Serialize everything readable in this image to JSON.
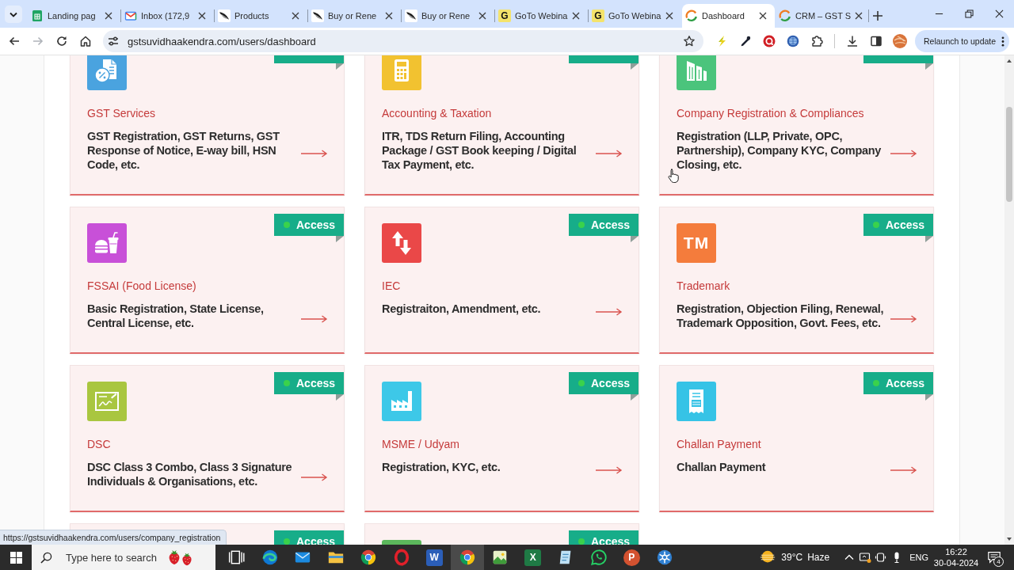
{
  "browser": {
    "tabs": [
      {
        "title": "Landing pag",
        "kind": "sheets",
        "selected": false
      },
      {
        "title": "Inbox (172,9",
        "kind": "mail",
        "selected": false
      },
      {
        "title": "Products",
        "kind": "quill",
        "selected": false
      },
      {
        "title": "Buy or Rene",
        "kind": "quill",
        "selected": false
      },
      {
        "title": "Buy or Rene",
        "kind": "quill",
        "selected": false
      },
      {
        "title": "GoTo Webina",
        "kind": "letter",
        "letter": "G",
        "selected": false
      },
      {
        "title": "GoTo Webina",
        "kind": "letter",
        "letter": "G",
        "selected": false
      },
      {
        "title": "Dashboard",
        "kind": "swoosh",
        "selected": true
      },
      {
        "title": "CRM – GST S",
        "kind": "swoosh",
        "selected": false
      }
    ],
    "forward_disabled": true,
    "url": "gstsuvidhaakendra.com/users/dashboard",
    "relaunch_button": "Relaunch to update",
    "status_url": "https://gstsuvidhaakendra.com/users/company_registration"
  },
  "services": [
    {
      "title": "GST Services",
      "description": "GST Registration, GST Returns, GST Response of Notice, E-way bill, HSN Code, etc.",
      "kind": "tax-document",
      "color": "#4aa3df",
      "has_access": true
    },
    {
      "title": "Accounting & Taxation",
      "description": "ITR, TDS Return Filing, Accounting Package / GST Book keeping / Digital Tax Payment, etc.",
      "kind": "calculator",
      "color": "#f2c230",
      "has_access": true
    },
    {
      "title": "Company Registration & Compliances",
      "description": "Registration (LLP, Private, OPC, Partnership), Company KYC, Company Closing, etc.",
      "kind": "buildings",
      "color": "#4bc47c",
      "has_access": true
    },
    {
      "title": "FSSAI (Food License)",
      "description": "Basic Registration, State License, Central License, etc.",
      "kind": "food",
      "color": "#c850d8",
      "has_access": true,
      "access_label": "Access"
    },
    {
      "title": "IEC",
      "description": "Registraiton, Amendment, etc.",
      "kind": "transfer",
      "color": "#ea4848",
      "has_access": true,
      "access_label": "Access"
    },
    {
      "title": "Trademark",
      "description": "Registration, Objection Filing, Renewal, Trademark Opposition, Govt. Fees, etc.",
      "kind": "trademark",
      "icon_text": "TM",
      "color": "#f47c3c",
      "has_access": true,
      "access_label": "Access"
    },
    {
      "title": "DSC",
      "description": "DSC Class 3 Combo, Class 3 Signature Individuals & Organisations, etc.",
      "kind": "certificate",
      "color": "#a9c640",
      "has_access": true,
      "access_label": "Access"
    },
    {
      "title": "MSME / Udyam",
      "description": "Registration, KYC, etc.",
      "kind": "factory",
      "color": "#3dc8e8",
      "has_access": true,
      "access_label": "Access"
    },
    {
      "title": "Challan Payment",
      "description": "Challan Payment",
      "kind": "receipt",
      "color": "#36c3e6",
      "has_access": true,
      "access_label": "Access"
    },
    {
      "has_access": true,
      "access_label": "Access"
    },
    {
      "kind": "tile",
      "color": "#5cb85c",
      "has_access": true,
      "access_label": "Access"
    }
  ],
  "taskbar": {
    "search_placeholder": "Type here to search",
    "apps": [
      {
        "kind": "edge",
        "selected": false
      },
      {
        "kind": "mail",
        "selected": false
      },
      {
        "kind": "folder",
        "selected": false
      },
      {
        "kind": "chrome",
        "selected": false
      },
      {
        "kind": "opera",
        "selected": false
      },
      {
        "kind": "letter-square",
        "letter": "W",
        "color": "#2b5eb8",
        "selected": false
      },
      {
        "kind": "chrome",
        "selected": true
      },
      {
        "kind": "photo",
        "selected": false
      },
      {
        "kind": "letter-square",
        "letter": "X",
        "color": "#1f7a45",
        "selected": false
      },
      {
        "kind": "notepad",
        "selected": false
      },
      {
        "kind": "chat",
        "selected": false
      },
      {
        "kind": "letter-circle",
        "letter": "P",
        "color": "#d35230",
        "selected": false
      },
      {
        "kind": "snowflake",
        "selected": false
      }
    ],
    "weather": {
      "temperature": "39°C",
      "condition": "Haze"
    },
    "language": "ENG",
    "time": "16:22",
    "date": "30-04-2024",
    "notification_count": "4"
  }
}
